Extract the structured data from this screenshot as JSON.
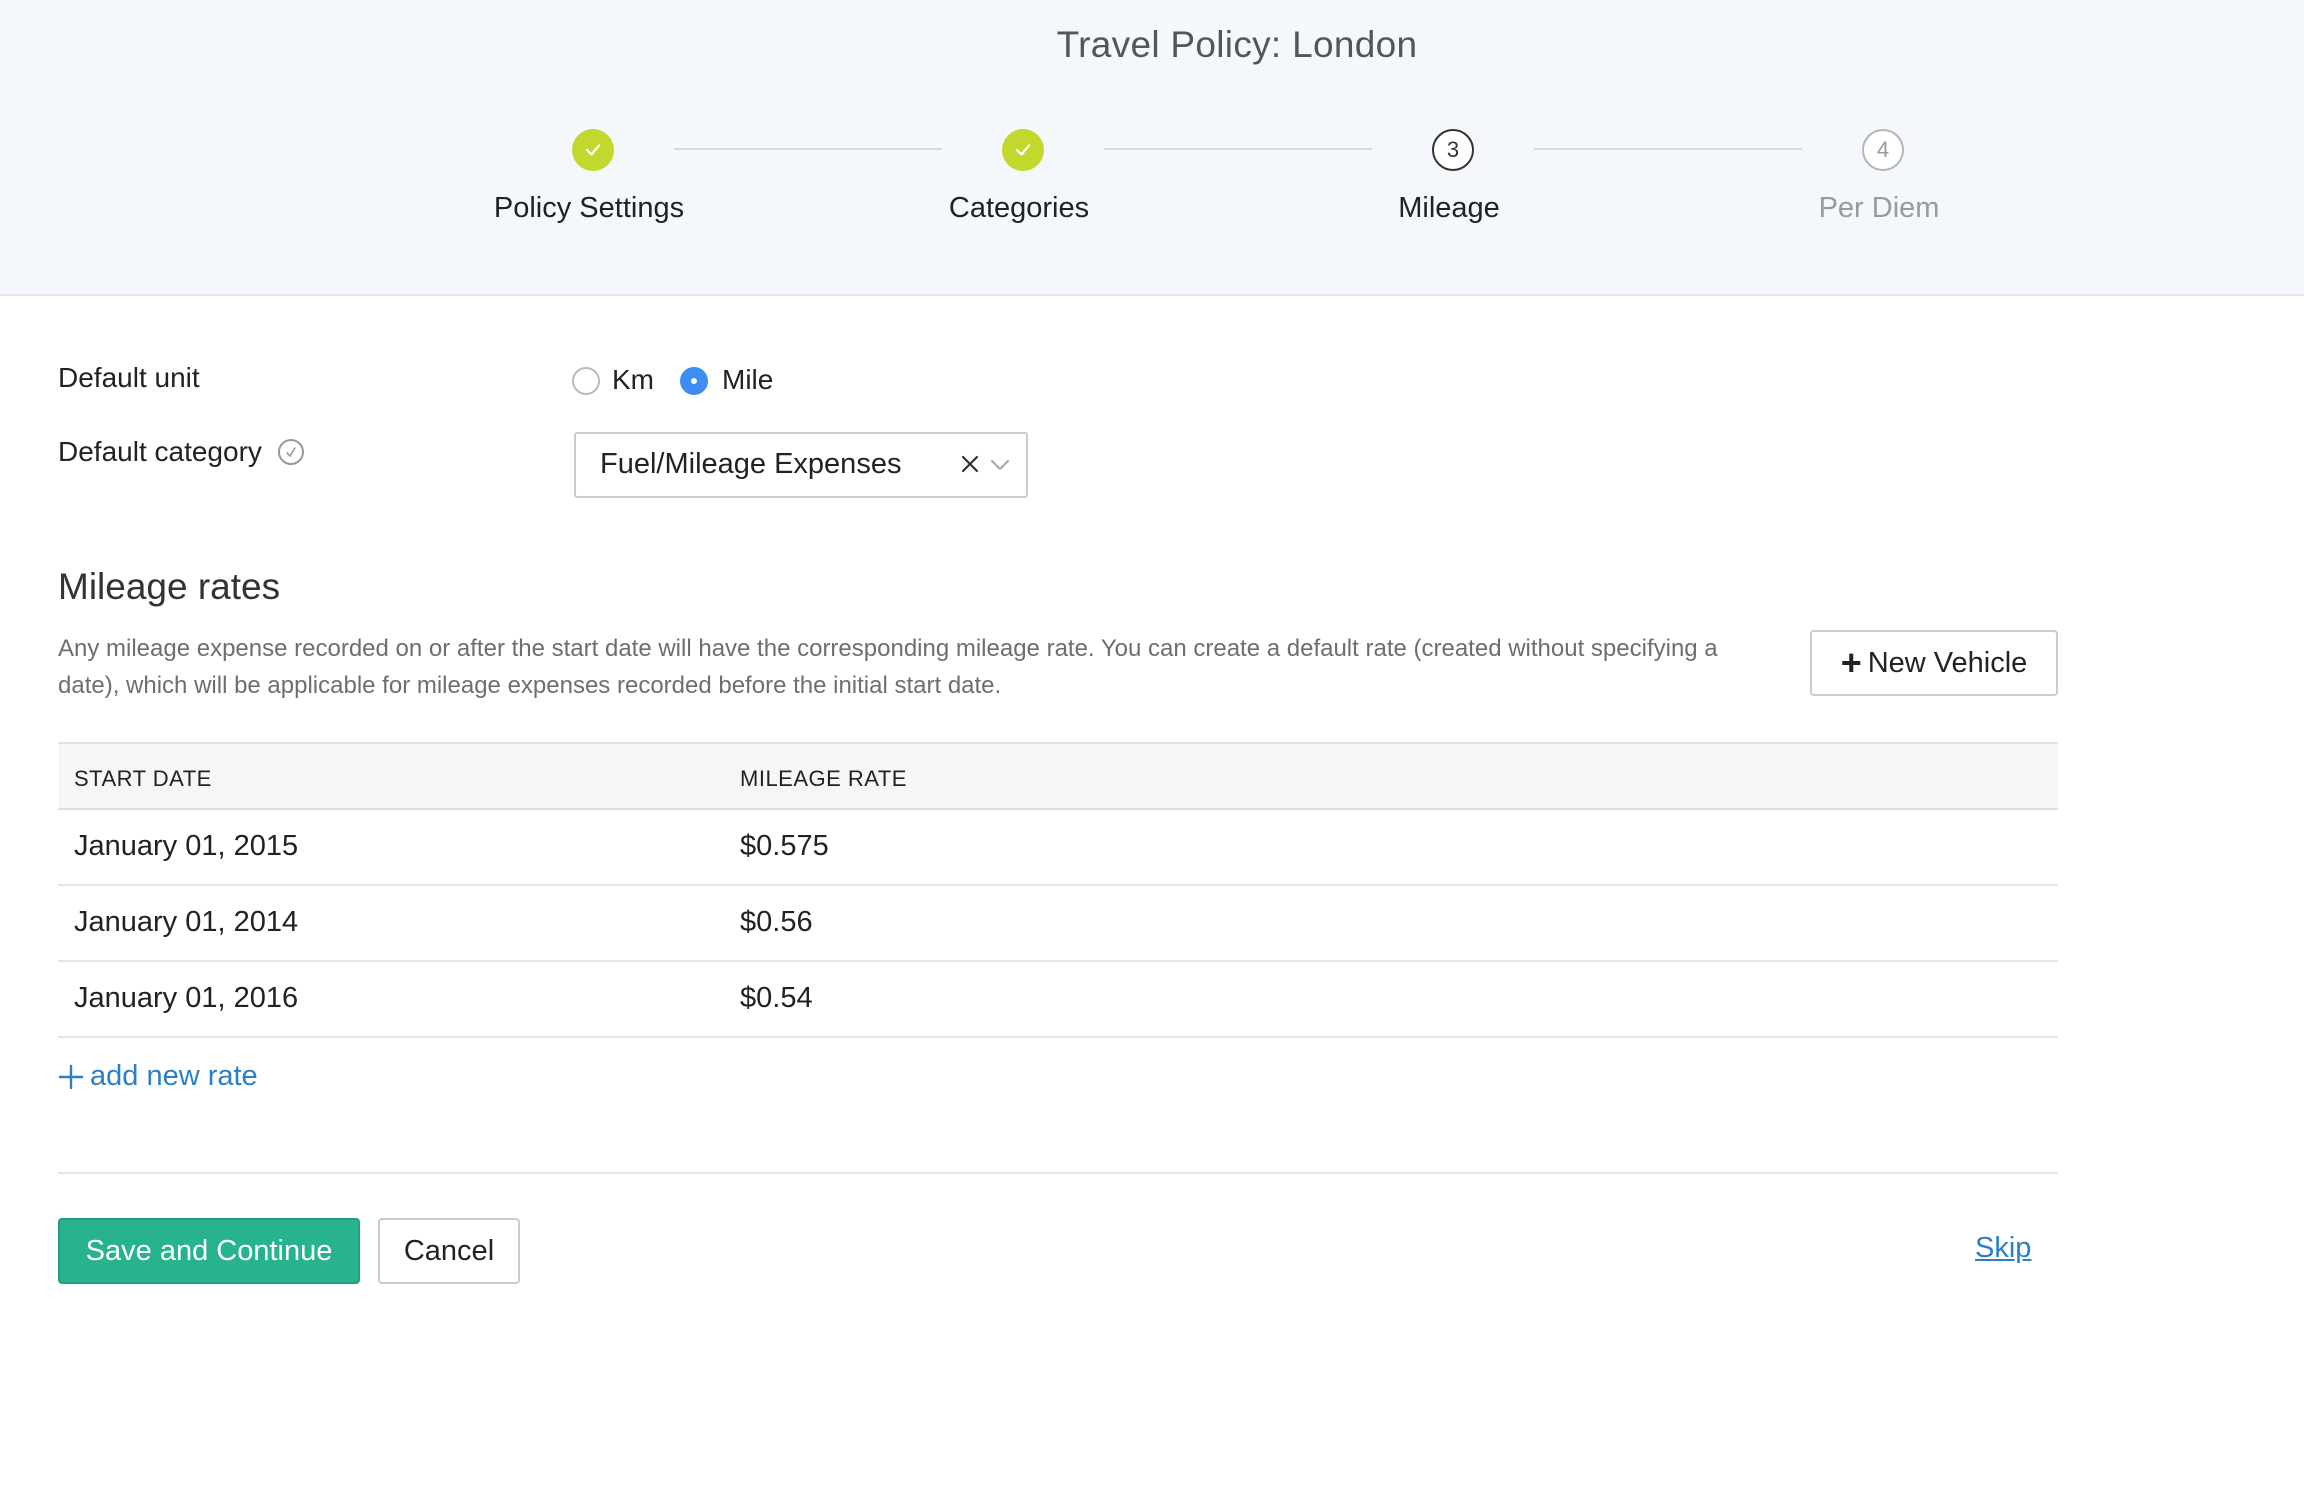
{
  "header": {
    "title": "Travel Policy: London",
    "steps": [
      {
        "label": "Policy Settings",
        "status": "done",
        "number": ""
      },
      {
        "label": "Categories",
        "status": "done",
        "number": ""
      },
      {
        "label": "Mileage",
        "status": "current",
        "number": "3"
      },
      {
        "label": "Per Diem",
        "status": "todo",
        "number": "4"
      }
    ]
  },
  "form": {
    "default_unit": {
      "label": "Default unit",
      "options": [
        "Km",
        "Mile"
      ],
      "selected": "Mile"
    },
    "default_category": {
      "label": "Default category",
      "value": "Fuel/Mileage Expenses"
    }
  },
  "mileage_rates": {
    "title": "Mileage rates",
    "description": "Any mileage expense recorded on or after the start date will have the corresponding mileage rate. You can create a default rate (created without specifying a date), which will be applicable for mileage expenses recorded before the initial start date.",
    "new_vehicle_label": "New Vehicle",
    "columns": [
      "START DATE",
      "MILEAGE RATE"
    ],
    "rows": [
      {
        "start_date": "January 01, 2015",
        "rate": "$0.575"
      },
      {
        "start_date": "January 01, 2014",
        "rate": "$0.56"
      },
      {
        "start_date": "January 01, 2016",
        "rate": "$0.54"
      }
    ],
    "add_rate_label": "add new rate"
  },
  "actions": {
    "save_label": "Save and Continue",
    "cancel_label": "Cancel",
    "skip_label": "Skip"
  },
  "colors": {
    "accent_done": "#c3d82c",
    "primary_button": "#28b38f",
    "link": "#2b7fc4",
    "radio_selected": "#3d8ef0",
    "header_bg": "#f4f8fc"
  }
}
